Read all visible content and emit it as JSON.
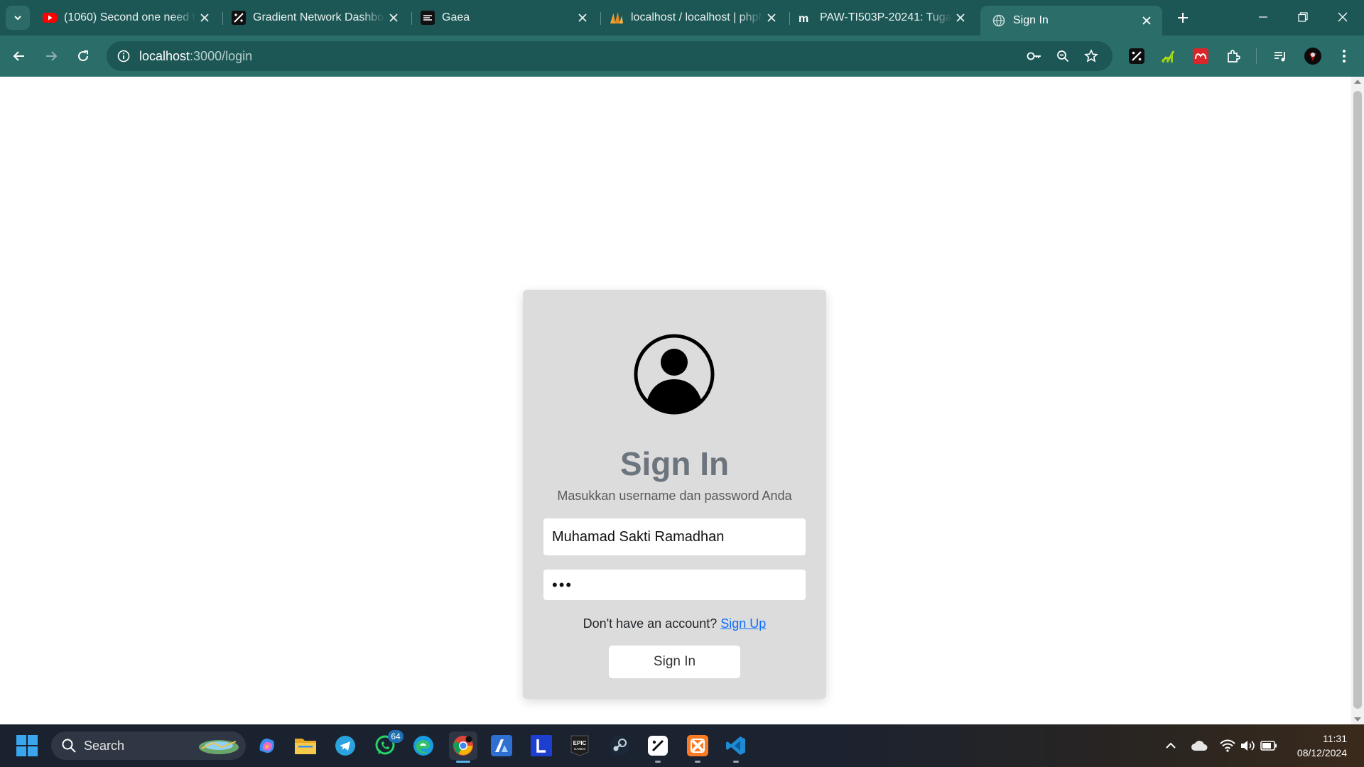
{
  "browser": {
    "tabs": [
      {
        "title": "(1060) Second one need to",
        "icon": "youtube-icon"
      },
      {
        "title": "Gradient Network Dashboard",
        "icon": "gradient-icon"
      },
      {
        "title": "Gaea",
        "icon": "gaea-icon"
      },
      {
        "title": "localhost / localhost | phpMyAdmin",
        "icon": "phpmyadmin-icon"
      },
      {
        "title": "PAW-TI503P-20241: Tugas",
        "icon": "moodle-icon"
      },
      {
        "title": "Sign In",
        "icon": "globe-icon",
        "active": true
      }
    ],
    "url_host": "localhost",
    "url_path": ":3000/login"
  },
  "page": {
    "title": "Sign In",
    "subtitle": "Masukkan username dan password Anda",
    "username_value": "Muhamad Sakti Ramadhan",
    "password_value": "•••",
    "signup_prompt": "Don't have an account?",
    "signup_link": "Sign Up",
    "submit_label": "Sign In"
  },
  "taskbar": {
    "search_label": "Search",
    "whatsapp_badge": "64",
    "time": "11:31",
    "date": "08/12/2024"
  },
  "colors": {
    "tab_strip": "#1c5755",
    "toolbar": "#2b6d69",
    "card_bg": "#dcdcdc",
    "title_gray": "#6c757d",
    "link_blue": "#0d6efd"
  }
}
